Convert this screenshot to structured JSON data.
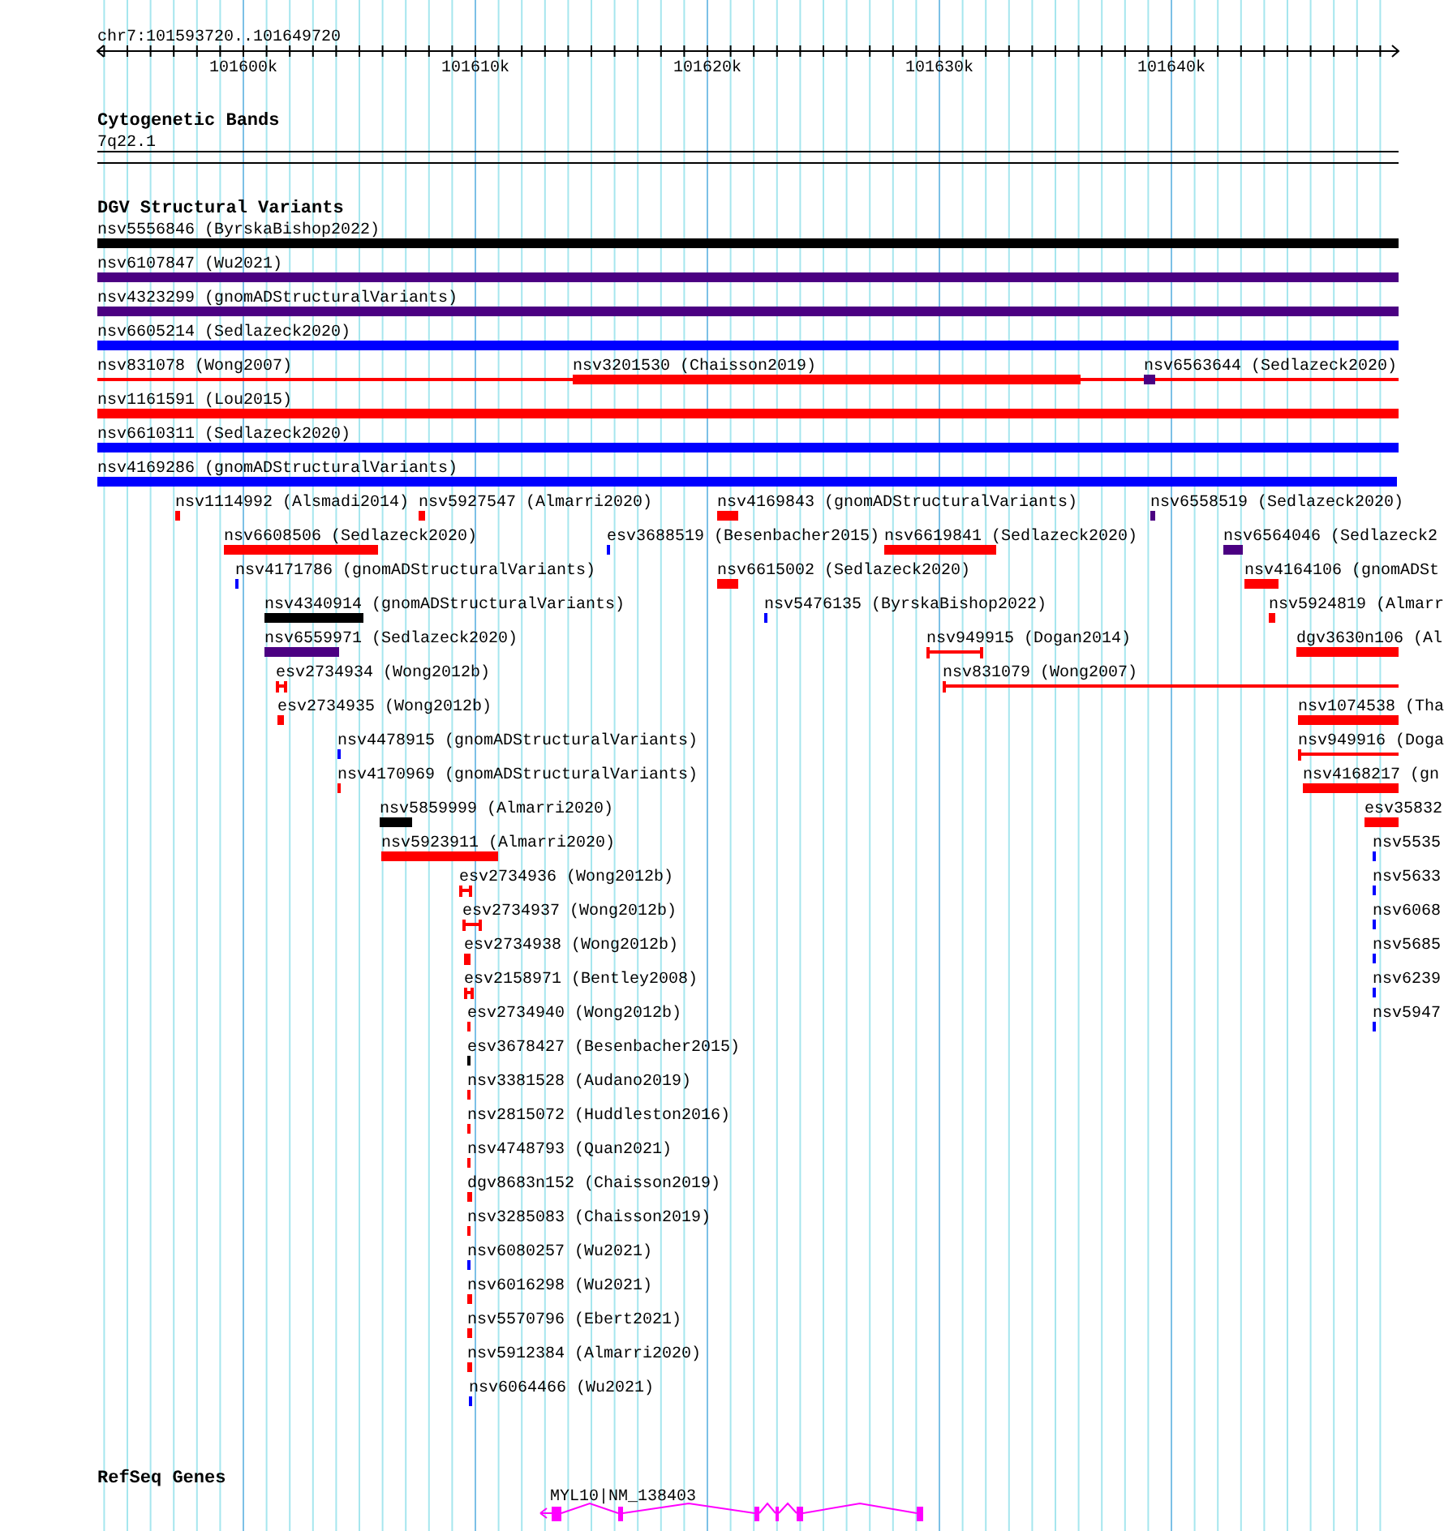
{
  "ruler": {
    "title": "chr7:101593720..101649720",
    "ticks": [
      "101600k",
      "101610k",
      "101620k",
      "101630k",
      "101640k"
    ]
  },
  "cytoband": {
    "title": "Cytogenetic Bands",
    "band": "7q22.1"
  },
  "dgv": {
    "title": "DGV Structural Variants",
    "features": [
      {
        "label": "nsv5556846 (ByrskaBishop2022)",
        "color": "#000000",
        "kind": "bar"
      },
      {
        "label": "nsv6107847 (Wu2021)",
        "color": "#4b0082",
        "kind": "bar"
      },
      {
        "label": "nsv4323299 (gnomADStructuralVariants)",
        "color": "#4b0082",
        "kind": "bar"
      },
      {
        "label": "nsv6605214 (Sedlazeck2020)",
        "color": "#0000ff",
        "kind": "bar"
      },
      {
        "label": "nsv831078 (Wong2007)",
        "color": "#ff0000",
        "kind": "interval"
      },
      {
        "label": "nsv3201530 (Chaisson2019)",
        "color": "#ff0000",
        "kind": "bar"
      },
      {
        "label": "nsv6563644 (Sedlazeck2020)",
        "color": "#4b0082",
        "kind": "bar"
      },
      {
        "label": "nsv1161591 (Lou2015)",
        "color": "#ff0000",
        "kind": "bar"
      },
      {
        "label": "nsv6610311 (Sedlazeck2020)",
        "color": "#0000ff",
        "kind": "bar"
      },
      {
        "label": "nsv4169286 (gnomADStructuralVariants)",
        "color": "#0000ff",
        "kind": "bar"
      },
      {
        "label": "nsv1114992 (Alsmadi2014)",
        "color": "#ff0000",
        "kind": "bar"
      },
      {
        "label": "nsv5927547 (Almarri2020)",
        "color": "#ff0000",
        "kind": "bar"
      },
      {
        "label": "nsv4169843 (gnomADStructuralVariants)",
        "color": "#ff0000",
        "kind": "bar"
      },
      {
        "label": "nsv6558519 (Sedlazeck2020)",
        "color": "#4b0082",
        "kind": "bar"
      },
      {
        "label": "nsv6608506 (Sedlazeck2020)",
        "color": "#ff0000",
        "kind": "bar"
      },
      {
        "label": "esv3688519 (Besenbacher2015)",
        "color": "#0000ff",
        "kind": "bar"
      },
      {
        "label": "nsv6619841 (Sedlazeck2020)",
        "color": "#ff0000",
        "kind": "bar"
      },
      {
        "label": "nsv6564046 (Sedlazeck2",
        "color": "#4b0082",
        "kind": "bar"
      },
      {
        "label": "nsv4171786 (gnomADStructuralVariants)",
        "color": "#0000ff",
        "kind": "bar"
      },
      {
        "label": "nsv6615002 (Sedlazeck2020)",
        "color": "#ff0000",
        "kind": "bar"
      },
      {
        "label": "nsv4164106 (gnomADSt",
        "color": "#ff0000",
        "kind": "bar"
      },
      {
        "label": "nsv4340914 (gnomADStructuralVariants)",
        "color": "#000000",
        "kind": "bar"
      },
      {
        "label": "nsv5476135 (ByrskaBishop2022)",
        "color": "#0000ff",
        "kind": "bar"
      },
      {
        "label": "nsv5924819 (Almarr",
        "color": "#ff0000",
        "kind": "bar"
      },
      {
        "label": "nsv6559971 (Sedlazeck2020)",
        "color": "#4b0082",
        "kind": "bar"
      },
      {
        "label": "nsv949915 (Dogan2014)",
        "color": "#ff0000",
        "kind": "interval"
      },
      {
        "label": "dgv3630n106 (Al",
        "color": "#ff0000",
        "kind": "bar"
      },
      {
        "label": "esv2734934 (Wong2012b)",
        "color": "#ff0000",
        "kind": "interval"
      },
      {
        "label": "nsv831079 (Wong2007)",
        "color": "#ff0000",
        "kind": "interval"
      },
      {
        "label": "esv2734935 (Wong2012b)",
        "color": "#ff0000",
        "kind": "bar"
      },
      {
        "label": "nsv1074538 (Tha",
        "color": "#ff0000",
        "kind": "bar"
      },
      {
        "label": "nsv4478915 (gnomADStructuralVariants)",
        "color": "#0000ff",
        "kind": "bar"
      },
      {
        "label": "nsv949916 (Doga",
        "color": "#ff0000",
        "kind": "interval"
      },
      {
        "label": "nsv4170969 (gnomADStructuralVariants)",
        "color": "#ff0000",
        "kind": "bar"
      },
      {
        "label": "nsv4168217 (gn",
        "color": "#ff0000",
        "kind": "bar"
      },
      {
        "label": "nsv5859999 (Almarri2020)",
        "color": "#000000",
        "kind": "bar"
      },
      {
        "label": "esv35832",
        "color": "#ff0000",
        "kind": "bar"
      },
      {
        "label": "nsv5923911 (Almarri2020)",
        "color": "#ff0000",
        "kind": "bar"
      },
      {
        "label": "nsv5535",
        "color": "#0000ff",
        "kind": "bar"
      },
      {
        "label": "esv2734936 (Wong2012b)",
        "color": "#ff0000",
        "kind": "interval"
      },
      {
        "label": "nsv5633",
        "color": "#0000ff",
        "kind": "bar"
      },
      {
        "label": "esv2734937 (Wong2012b)",
        "color": "#ff0000",
        "kind": "interval"
      },
      {
        "label": "nsv6068",
        "color": "#0000ff",
        "kind": "bar"
      },
      {
        "label": "esv2734938 (Wong2012b)",
        "color": "#ff0000",
        "kind": "interval"
      },
      {
        "label": "nsv5685",
        "color": "#0000ff",
        "kind": "bar"
      },
      {
        "label": "esv2158971 (Bentley2008)",
        "color": "#ff0000",
        "kind": "interval"
      },
      {
        "label": "nsv6239",
        "color": "#0000ff",
        "kind": "bar"
      },
      {
        "label": "esv2734940 (Wong2012b)",
        "color": "#ff0000",
        "kind": "bar"
      },
      {
        "label": "nsv5947",
        "color": "#0000ff",
        "kind": "bar"
      },
      {
        "label": "esv3678427 (Besenbacher2015)",
        "color": "#000000",
        "kind": "bar"
      },
      {
        "label": "nsv3381528 (Audano2019)",
        "color": "#ff0000",
        "kind": "bar"
      },
      {
        "label": "nsv2815072 (Huddleston2016)",
        "color": "#ff0000",
        "kind": "bar"
      },
      {
        "label": "nsv4748793 (Quan2021)",
        "color": "#ff0000",
        "kind": "bar"
      },
      {
        "label": "dgv8683n152 (Chaisson2019)",
        "color": "#ff0000",
        "kind": "bar"
      },
      {
        "label": "nsv3285083 (Chaisson2019)",
        "color": "#ff0000",
        "kind": "bar"
      },
      {
        "label": "nsv6080257 (Wu2021)",
        "color": "#0000ff",
        "kind": "bar"
      },
      {
        "label": "nsv6016298 (Wu2021)",
        "color": "#ff0000",
        "kind": "bar"
      },
      {
        "label": "nsv5570796 (Ebert2021)",
        "color": "#ff0000",
        "kind": "bar"
      },
      {
        "label": "nsv5912384 (Almarri2020)",
        "color": "#ff0000",
        "kind": "bar"
      },
      {
        "label": "nsv6064466 (Wu2021)",
        "color": "#0000ff",
        "kind": "bar"
      }
    ]
  },
  "refseq": {
    "title": "RefSeq Genes",
    "gene": "MYL10|NM_138403"
  }
}
